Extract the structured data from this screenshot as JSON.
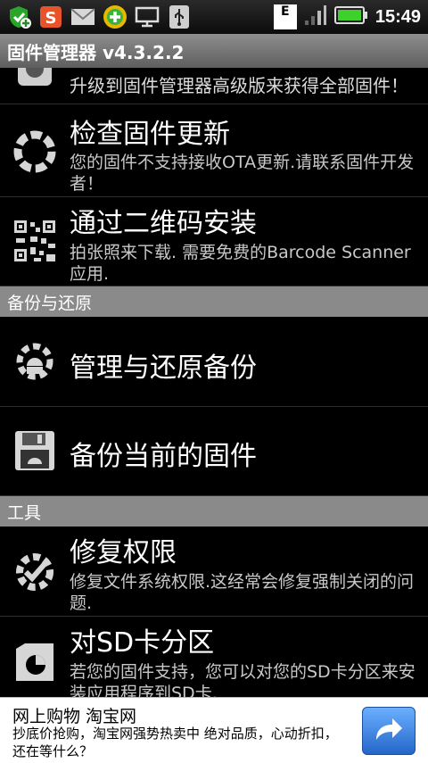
{
  "status_bar": {
    "time": "15:49",
    "edge_label": "E",
    "icons": [
      "shield-plus-icon",
      "sogou-s-icon",
      "mail-icon",
      "plus-badge-icon",
      "monitor-icon",
      "usb-icon",
      "network-e-icon",
      "signal-icon",
      "battery-icon"
    ]
  },
  "titlebar": {
    "title": "固件管理器 v4.3.2.2"
  },
  "items": {
    "upgrade": {
      "desc": "升级到固件管理器高级版来获得全部固件！"
    },
    "check_update": {
      "title": "检查固件更新",
      "desc": "您的固件不支持接收OTA更新.请联系固件开发者！"
    },
    "qr_install": {
      "title": "通过二维码安装",
      "desc": "拍张照来下载. 需要免费的Barcode Scanner 应用."
    },
    "manage_backup": {
      "title": "管理与还原备份"
    },
    "backup_current": {
      "title": "备份当前的固件"
    },
    "fix_permissions": {
      "title": "修复权限",
      "desc": "修复文件系统权限.这经常会修复强制关闭的问题."
    },
    "sd_partition": {
      "title": "对SD卡分区",
      "desc": "若您的固件支持，您可以对您的SD卡分区来安装应用程序到SD卡."
    }
  },
  "sections": {
    "backup": "备份与还原",
    "tools": "工具"
  },
  "ad": {
    "title": "网上购物 淘宝网",
    "desc": "抄底价抢购，淘宝网强势热卖中 绝对品质，心动折扣，还在等什么？"
  },
  "colors": {
    "section_header": "#8a8a8a",
    "battery": "#3fd12b",
    "ad_button": "#2f7be0"
  }
}
